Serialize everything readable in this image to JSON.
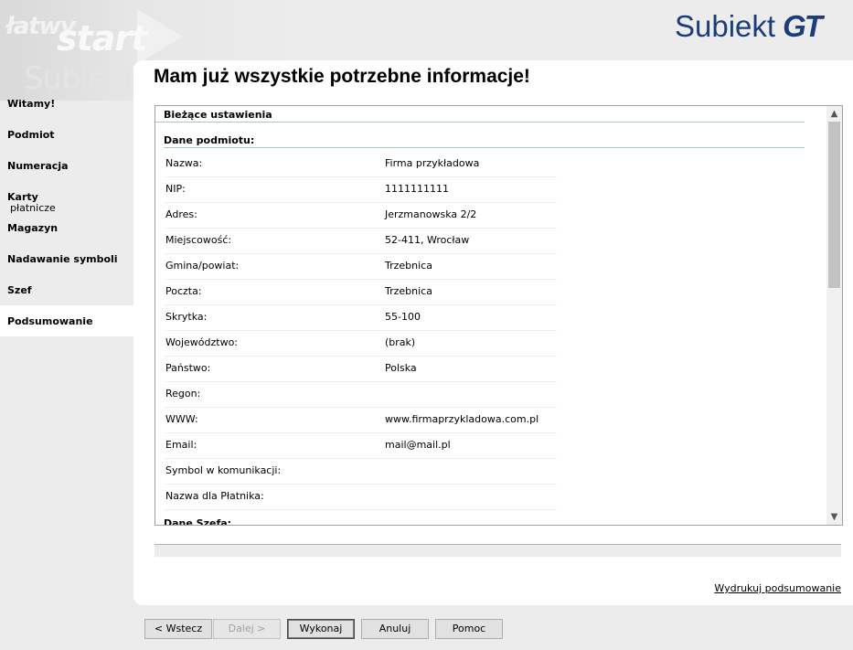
{
  "watermark": {
    "line1": "łatwy",
    "line2": "start",
    "line3": "Subiekt"
  },
  "brand": {
    "name": "Subiekt",
    "suffix": "GT"
  },
  "sidebar": {
    "items": [
      {
        "label": "Witamy!",
        "sub": ""
      },
      {
        "label": "Podmiot",
        "sub": ""
      },
      {
        "label": "Numeracja",
        "sub": ""
      },
      {
        "label": "Karty",
        "sub": "płatnicze"
      },
      {
        "label": "Magazyn",
        "sub": ""
      },
      {
        "label": "Nadawanie symboli",
        "sub": ""
      },
      {
        "label": "Szef",
        "sub": ""
      },
      {
        "label": "Podsumowanie",
        "sub": "",
        "active": true
      }
    ]
  },
  "main": {
    "title": "Mam już wszystkie potrzebne informacje!",
    "settings": {
      "header": "Bieżące ustawienia",
      "section1": "Dane podmiotu:",
      "rows": [
        {
          "label": "Nazwa:",
          "value": "Firma przykładowa"
        },
        {
          "label": "NIP:",
          "value": "1111111111"
        },
        {
          "label": "Adres:",
          "value": "Jerzmanowska 2/2"
        },
        {
          "label": "Miejscowość:",
          "value": "52-411, Wrocław"
        },
        {
          "label": "Gmina/powiat:",
          "value": "Trzebnica"
        },
        {
          "label": "Poczta:",
          "value": "Trzebnica"
        },
        {
          "label": "Skrytka:",
          "value": "55-100"
        },
        {
          "label": "Województwo:",
          "value": "(brak)"
        },
        {
          "label": "Państwo:",
          "value": "Polska"
        },
        {
          "label": "Regon:",
          "value": ""
        },
        {
          "label": "WWW:",
          "value": "www.firmaprzykladowa.com.pl"
        },
        {
          "label": "Email:",
          "value": "mail@mail.pl"
        },
        {
          "label": "Symbol w komunikacji:",
          "value": ""
        },
        {
          "label": "Nazwa dla Płatnika:",
          "value": ""
        }
      ],
      "section2": "Dane Szefa:"
    },
    "print_link": "Wydrukuj podsumowanie"
  },
  "buttons": {
    "back": "< Wstecz",
    "next": "Dalej >",
    "execute": "Wykonaj",
    "cancel": "Anuluj",
    "help": "Pomoc"
  },
  "colors": {
    "brand": "#1b3d7a",
    "section_line": "#a8c6cc"
  }
}
